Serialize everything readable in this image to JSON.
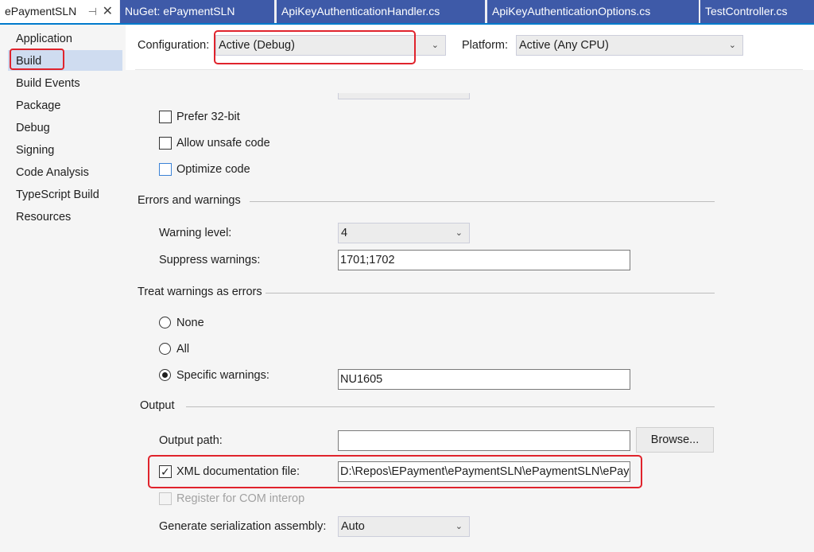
{
  "tabs": [
    {
      "label": "ePaymentSLN",
      "active": true
    },
    {
      "label": "NuGet: ePaymentSLN",
      "active": false
    },
    {
      "label": "ApiKeyAuthenticationHandler.cs",
      "active": false
    },
    {
      "label": "ApiKeyAuthenticationOptions.cs",
      "active": false
    },
    {
      "label": "TestController.cs",
      "active": false
    }
  ],
  "icons": {
    "pin": "pin-icon",
    "close": "close-icon",
    "chevron": "chevron-down-icon"
  },
  "nav": {
    "items": [
      "Application",
      "Build",
      "Build Events",
      "Package",
      "Debug",
      "Signing",
      "Code Analysis",
      "TypeScript Build",
      "Resources"
    ],
    "selected": "Build"
  },
  "config": {
    "configuration_label": "Configuration:",
    "configuration_value": "Active (Debug)",
    "platform_label": "Platform:",
    "platform_value": "Active (Any CPU)"
  },
  "general": {
    "prefer32": {
      "label": "Prefer 32-bit",
      "checked": false
    },
    "unsafe": {
      "label": "Allow unsafe code",
      "checked": false
    },
    "optimize": {
      "label": "Optimize code",
      "checked": false
    }
  },
  "errors": {
    "heading": "Errors and warnings",
    "warning_level_label": "Warning level:",
    "warning_level_value": "4",
    "suppress_label": "Suppress warnings:",
    "suppress_value": "1701;1702"
  },
  "treat": {
    "heading": "Treat warnings as errors",
    "none": "None",
    "all": "All",
    "specific": "Specific warnings:",
    "specific_value": "NU1605",
    "selected": "specific"
  },
  "output": {
    "heading": "Output",
    "path_label": "Output path:",
    "path_value": "",
    "browse": "Browse...",
    "xml_label": "XML documentation file:",
    "xml_checked": true,
    "xml_value": "D:\\Repos\\EPayment\\ePaymentSLN\\ePaymentSLN\\ePayme",
    "com_label": "Register for COM interop",
    "com_checked": false,
    "serialization_label": "Generate serialization assembly:",
    "serialization_value": "Auto"
  },
  "colors": {
    "accent": "#007acc",
    "highlight_box": "#e0232c",
    "tab_inactive": "#3e5aa8"
  }
}
